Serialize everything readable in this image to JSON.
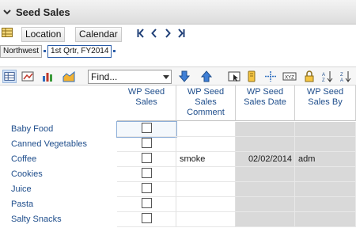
{
  "title": "Seed Sales",
  "nav": {
    "location_label": "Location",
    "calendar_label": "Calendar"
  },
  "crumbs": [
    {
      "label": "Northwest"
    },
    {
      "label": "1st Qrtr, FY2014"
    }
  ],
  "find": {
    "value": "Find..."
  },
  "columns": [
    {
      "label": "WP Seed Sales"
    },
    {
      "label": "WP Seed Sales Comment"
    },
    {
      "label": "WP Seed Sales Date"
    },
    {
      "label": "WP Seed Sales By"
    }
  ],
  "rows": [
    {
      "label": "Baby Food",
      "checked": false,
      "comment": "",
      "date": "",
      "by": ""
    },
    {
      "label": "Canned Vegetables",
      "checked": false,
      "comment": "",
      "date": "",
      "by": ""
    },
    {
      "label": "Coffee",
      "checked": false,
      "comment": "smoke",
      "date": "02/02/2014",
      "by": "adm"
    },
    {
      "label": "Cookies",
      "checked": false,
      "comment": "",
      "date": "",
      "by": ""
    },
    {
      "label": "Juice",
      "checked": false,
      "comment": "",
      "date": "",
      "by": ""
    },
    {
      "label": "Pasta",
      "checked": false,
      "comment": "",
      "date": "",
      "by": ""
    },
    {
      "label": "Salty Snacks",
      "checked": false,
      "comment": "",
      "date": "",
      "by": ""
    }
  ],
  "colors": {
    "accent": "#2c5da8",
    "link_text": "#1f4e8c",
    "readonly_cell": "#d9d9d9"
  },
  "icons": [
    "chevron-down-icon",
    "grid-icon",
    "first-page-icon",
    "previous-icon",
    "next-icon",
    "last-page-icon",
    "grid-view-icon",
    "chart-icon",
    "bar-chart-icon",
    "area-chart-icon",
    "down-arrow-icon",
    "up-arrow-icon",
    "select-icon",
    "highlight-icon",
    "split-icon",
    "xyz-icon",
    "lock-icon",
    "sort-asc-icon",
    "sort-desc-icon"
  ]
}
